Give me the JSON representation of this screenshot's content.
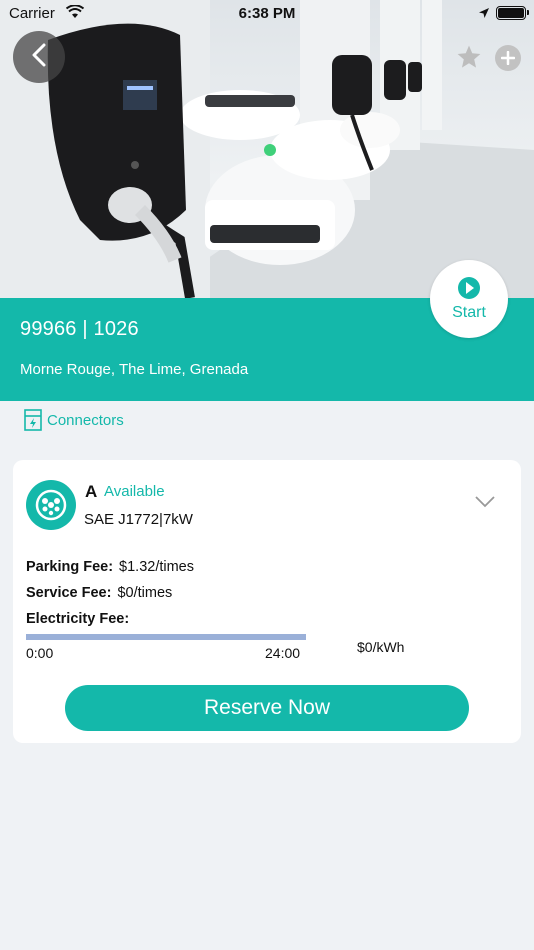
{
  "status_bar": {
    "carrier": "Carrier",
    "time": "6:38 PM"
  },
  "station": {
    "id": "99966 | 1026",
    "address": "Morne Rouge, The Lime, Grenada"
  },
  "actions": {
    "start_label": "Start"
  },
  "tabs": {
    "connectors_label": "Connectors"
  },
  "connector": {
    "letter": "A",
    "status": "Available",
    "type": "SAE J1772|7kW",
    "fees": {
      "parking_label": "Parking Fee:",
      "parking_value": "$1.32/times",
      "service_label": "Service Fee:",
      "service_value": "$0/times",
      "electricity_label": "Electricity Fee:"
    },
    "timeline": {
      "start": "0:00",
      "end": "24:00",
      "price": "$0/kWh"
    },
    "reserve_label": "Reserve Now"
  },
  "colors": {
    "accent": "#14b8aa",
    "timeline": "#9ab0d8",
    "background": "#eff2f5"
  },
  "icons": [
    "back-arrow-icon",
    "star-icon",
    "plus-icon",
    "play-icon",
    "connector-icon",
    "plug-icon",
    "chevron-down-icon",
    "wifi-icon",
    "location-arrow-icon",
    "battery-icon"
  ]
}
